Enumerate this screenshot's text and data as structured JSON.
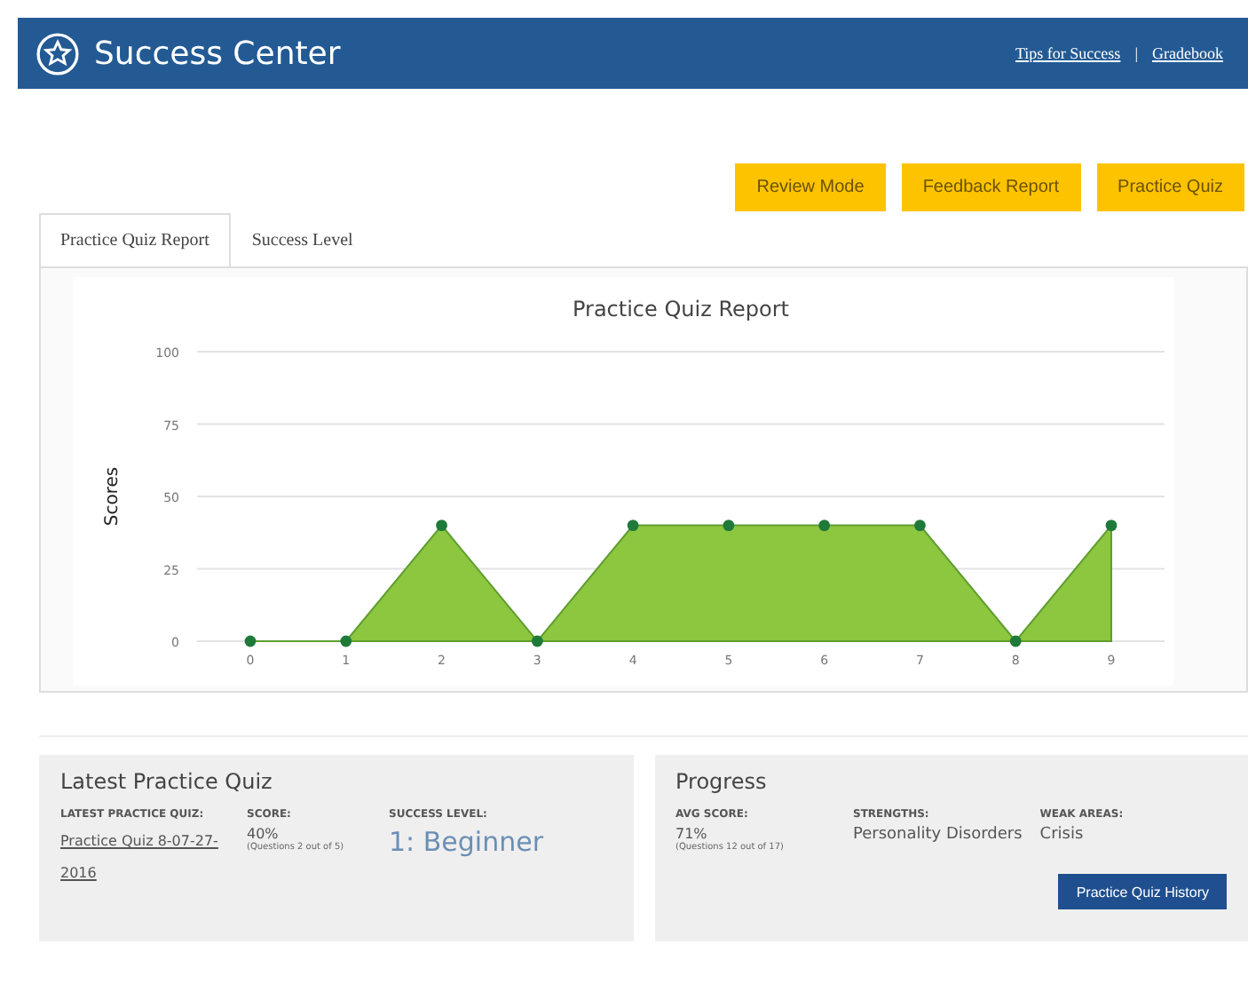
{
  "header": {
    "title": "Success Center",
    "links": [
      "Tips for Success",
      "Gradebook"
    ],
    "separator": "|"
  },
  "actions": [
    "Review Mode",
    "Feedback Report",
    "Practice Quiz"
  ],
  "tabs": [
    {
      "label": "Practice Quiz Report",
      "selected": true
    },
    {
      "label": "Success Level",
      "selected": false
    }
  ],
  "chart_data": {
    "type": "area",
    "title": "Practice Quiz Report",
    "ylabel": "Scores",
    "categories": [
      "0",
      "1",
      "2",
      "3",
      "4",
      "5",
      "6",
      "7",
      "8",
      "9"
    ],
    "grid": true,
    "series": [
      {
        "color": "#8dc63f",
        "values": [
          0,
          0,
          40,
          0,
          40,
          40,
          40,
          40,
          0,
          40
        ]
      }
    ],
    "ylim": [
      0,
      100
    ],
    "yticks": [
      0,
      25,
      50,
      75,
      100
    ]
  },
  "latest": {
    "title": "Latest Practice Quiz",
    "quiz_label": "LATEST PRACTICE QUIZ:",
    "quiz_link": "Practice Quiz 8-07-27-2016",
    "score_label": "SCORE:",
    "score": "40%",
    "score_note": "(Questions 2 out of 5)",
    "level_label": "SUCCESS LEVEL:",
    "level": "1: Beginner"
  },
  "progress": {
    "title": "Progress",
    "avg_label": "AVG SCORE:",
    "avg": "71%",
    "avg_note": "(Questions 12 out of 17)",
    "strengths_label": "STRENGTHS:",
    "strengths": "Personality Disorders",
    "weak_label": "WEAK AREAS:",
    "weak": "Crisis",
    "button": "Practice Quiz History"
  }
}
